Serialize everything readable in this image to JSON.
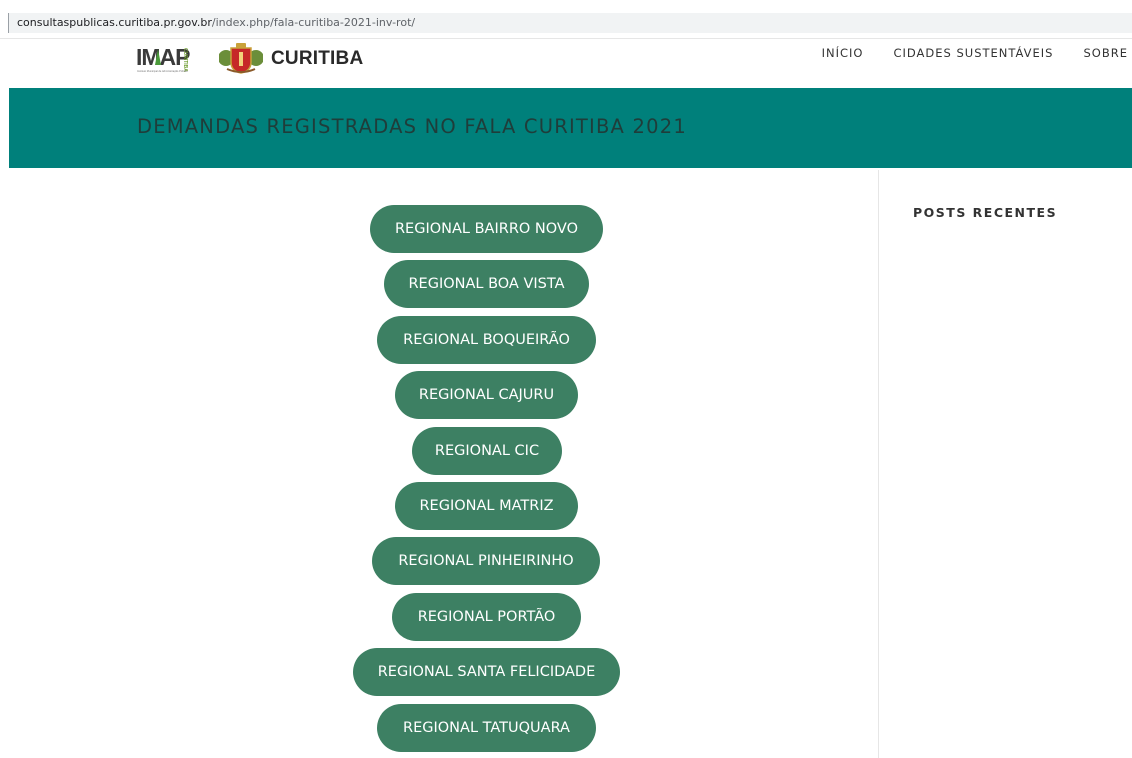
{
  "browser": {
    "url_domain": "consultaspublicas.curitiba.pr.gov.br",
    "url_path": "/index.php/fala-curitiba-2021-inv-rot/"
  },
  "header": {
    "logo_imap": "IMAP",
    "logo_imap_side": "CURITIBA",
    "logo_imap_caption": "Instituto Municipal de Administração Pública",
    "logo_curitiba": "CURITIBA",
    "nav": [
      "INÍCIO",
      "CIDADES SUSTENTÁVEIS",
      "SOBRE"
    ]
  },
  "banner": {
    "title": "DEMANDAS REGISTRADAS NO FALA CURITIBA 2021",
    "color": "#00807b"
  },
  "regionals": [
    "REGIONAL BAIRRO NOVO",
    "REGIONAL BOA VISTA",
    "REGIONAL BOQUEIRÃO",
    "REGIONAL CAJURU",
    "REGIONAL CIC",
    "REGIONAL MATRIZ",
    "REGIONAL PINHEIRINHO",
    "REGIONAL PORTÃO",
    "REGIONAL SANTA FELICIDADE",
    "REGIONAL TATUQUARA"
  ],
  "button_color": "#3d8063",
  "sidebar": {
    "title": "POSTS RECENTES"
  }
}
